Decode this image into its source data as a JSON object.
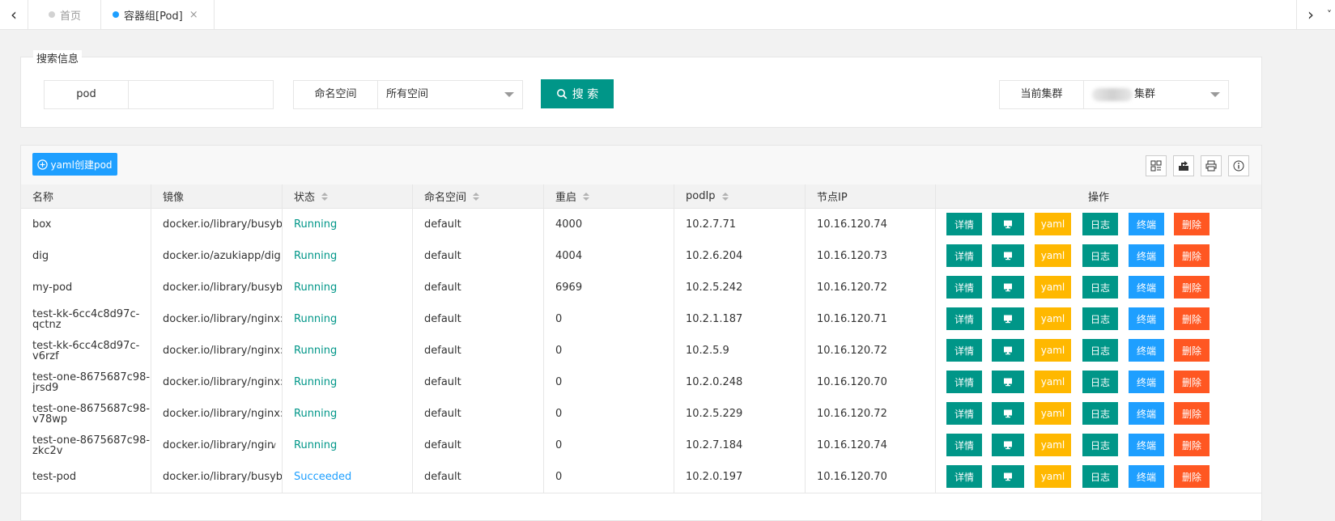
{
  "tabs": {
    "home": "首页",
    "pod": "容器组[Pod]",
    "close": "×"
  },
  "search": {
    "legend": "搜索信息",
    "pod_label": "pod",
    "pod_value": "",
    "namespace_label": "命名空间",
    "namespace_value": "所有空间",
    "button": "搜 索",
    "cluster_label": "当前集群",
    "cluster_value": "集群"
  },
  "toolbar": {
    "create": "yaml创建pod"
  },
  "table": {
    "headers": [
      "名称",
      "镜像",
      "状态",
      "命名空间",
      "重启",
      "podIp",
      "节点IP",
      "操作"
    ],
    "ops": [
      "详情",
      "",
      "yaml",
      "日志",
      "终端",
      "删除"
    ],
    "rows": [
      {
        "name": "box",
        "image": "docker.io/library/busybox",
        "status": "Running",
        "ns": "default",
        "restarts": "4000",
        "podip": "10.2.7.71",
        "node": "10.16.120.74"
      },
      {
        "name": "dig",
        "image": "docker.io/azukiapp/dig:la",
        "status": "Running",
        "ns": "default",
        "restarts": "4004",
        "podip": "10.2.6.204",
        "node": "10.16.120.73"
      },
      {
        "name": "my-pod",
        "image": "docker.io/library/busybox",
        "status": "Running",
        "ns": "default",
        "restarts": "6969",
        "podip": "10.2.5.242",
        "node": "10.16.120.72"
      },
      {
        "name": "test-kk-6cc4c8d97c-qctnz",
        "image": "docker.io/library/nginx:lat",
        "status": "Running",
        "ns": "default",
        "restarts": "0",
        "podip": "10.2.1.187",
        "node": "10.16.120.71"
      },
      {
        "name": "test-kk-6cc4c8d97c-v6rzf",
        "image": "docker.io/library/nginx:lat",
        "status": "Running",
        "ns": "default",
        "restarts": "0",
        "podip": "10.2.5.9",
        "node": "10.16.120.72"
      },
      {
        "name": "test-one-8675687c98-jrsd9",
        "image": "docker.io/library/nginx:lat",
        "status": "Running",
        "ns": "default",
        "restarts": "0",
        "podip": "10.2.0.248",
        "node": "10.16.120.70"
      },
      {
        "name": "test-one-8675687c98-v78wp",
        "image": "docker.io/library/nginx:lat",
        "status": "Running",
        "ns": "default",
        "restarts": "0",
        "podip": "10.2.5.229",
        "node": "10.16.120.72"
      },
      {
        "name": "test-one-8675687c98-zkc2v",
        "image": "docker.io/library/ngin",
        "status": "Running",
        "ns": "default",
        "restarts": "0",
        "podip": "10.2.7.184",
        "node": "10.16.120.74"
      },
      {
        "name": "test-pod",
        "image": "docker.io/library/busybox",
        "status": "Succeeded",
        "ns": "default",
        "restarts": "0",
        "podip": "10.2.0.197",
        "node": "10.16.120.70"
      }
    ]
  },
  "colors": {
    "primary": "#009688",
    "blue": "#1e9fff",
    "warn": "#ffb800",
    "danger": "#ff5722"
  }
}
